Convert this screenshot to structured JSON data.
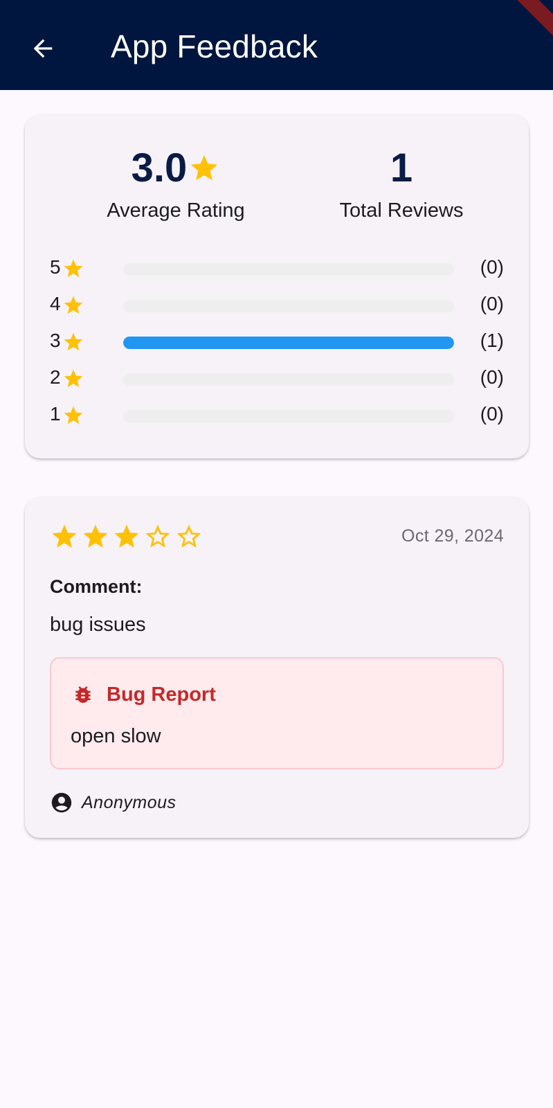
{
  "app_bar": {
    "title": "App Feedback",
    "back_icon": "arrow-back-icon",
    "background_color": "#00163e"
  },
  "summary": {
    "average_rating": "3.0",
    "average_label": "Average Rating",
    "total_reviews": "1",
    "total_label": "Total Reviews",
    "star_color": "#ffc107",
    "bar_color": "#2196f3",
    "distribution": [
      {
        "stars": "5",
        "count": "(0)",
        "fraction": 0
      },
      {
        "stars": "4",
        "count": "(0)",
        "fraction": 0
      },
      {
        "stars": "3",
        "count": "(1)",
        "fraction": 1
      },
      {
        "stars": "2",
        "count": "(0)",
        "fraction": 0
      },
      {
        "stars": "1",
        "count": "(0)",
        "fraction": 0
      }
    ]
  },
  "review": {
    "rating": 3,
    "max_rating": 5,
    "date": "Oct 29, 2024",
    "comment_label": "Comment:",
    "comment": "bug issues",
    "bug_report": {
      "title": "Bug Report",
      "icon": "bug-icon",
      "text": "open slow",
      "accent_color": "#c62828"
    },
    "author_icon": "account-circle-icon",
    "author": "Anonymous"
  }
}
